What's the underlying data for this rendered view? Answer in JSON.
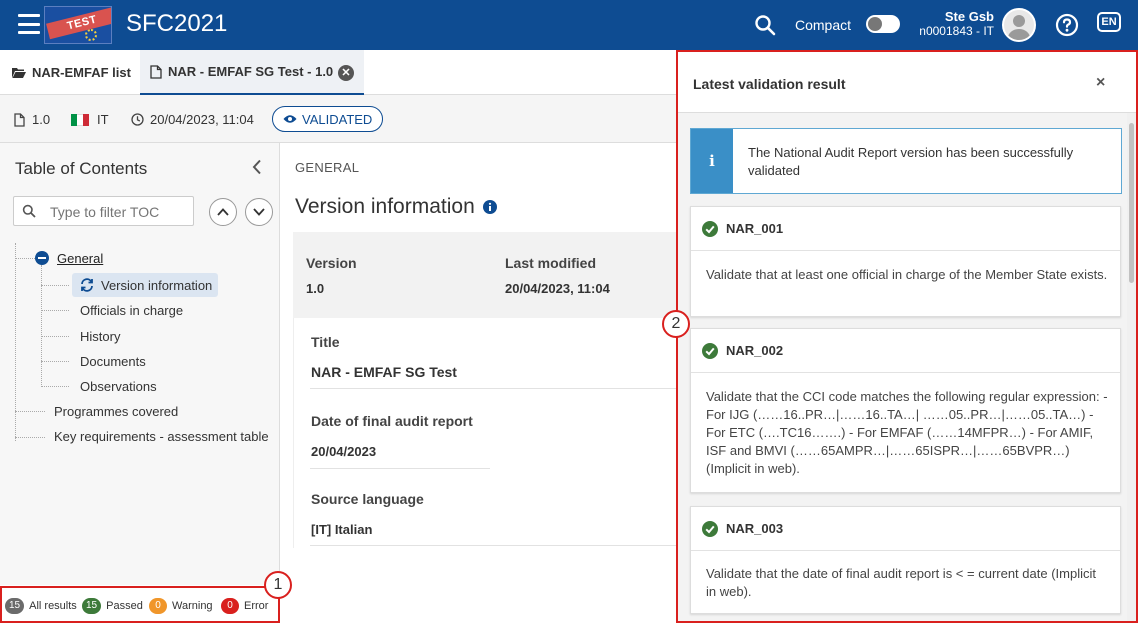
{
  "header": {
    "app_title": "SFC2021",
    "logo_text": "TEST",
    "compact_label": "Compact",
    "user_name": "Ste Gsb",
    "user_code": "n0001843 - IT",
    "lang": "EN",
    "brand_color": "#0e4c92"
  },
  "tabs": [
    {
      "label": "NAR-EMFAF list",
      "icon": "folder-open-icon"
    },
    {
      "label": "NAR - EMFAF SG Test - 1.0",
      "icon": "document-icon",
      "active": true
    }
  ],
  "infobar": {
    "version": "1.0",
    "country": "IT",
    "datetime": "20/04/2023, 11:04",
    "status": "VALIDATED"
  },
  "toc": {
    "title": "Table of Contents",
    "filter_placeholder": "Type to filter TOC",
    "general": "General",
    "children": [
      "Version information",
      "Officials in charge",
      "History",
      "Documents",
      "Observations"
    ],
    "others": [
      "Programmes covered",
      "Key requirements - assessment table"
    ]
  },
  "main": {
    "section": "GENERAL",
    "title": "Version information",
    "version_label": "Version",
    "version_value": "1.0",
    "modified_label": "Last modified",
    "modified_value": "20/04/2023, 11:04",
    "title_label": "Title",
    "title_value": "NAR - EMFAF SG Test",
    "final_date_label": "Date of final audit report",
    "final_date_value": "20/04/2023",
    "source_lang_label": "Source language",
    "source_lang_value": "[IT] Italian"
  },
  "status_bar": {
    "all_count": "15",
    "all_label": "All results",
    "passed_count": "15",
    "passed_label": "Passed",
    "warning_count": "0",
    "warning_label": "Warning",
    "error_count": "0",
    "error_label": "Error",
    "colors": {
      "all": "#6b6b6b",
      "passed": "#3d7a3a",
      "warning": "#f0962a",
      "error": "#d9201e"
    }
  },
  "callouts": {
    "one": "1",
    "two": "2"
  },
  "panel": {
    "title": "Latest validation result",
    "close": "×",
    "info_message": "The National Audit Report version has been successfully validated",
    "rules": [
      {
        "code": "NAR_001",
        "text": "Validate that at least one official in charge of the Member State exists."
      },
      {
        "code": "NAR_002",
        "text": "Validate that the CCI code matches the following regular expression: - For IJG (……16..PR…|……16..TA…| ……05..PR…|……05..TA…) - For ETC (….TC16…….) - For EMFAF (……14MFPR…) - For AMIF, ISF and BMVI (……65AMPR…|……65ISPR…|……65BVPR…) (Implicit in web)."
      },
      {
        "code": "NAR_003",
        "text": "Validate that the date of final audit report is < = current date (Implicit in web)."
      }
    ]
  }
}
